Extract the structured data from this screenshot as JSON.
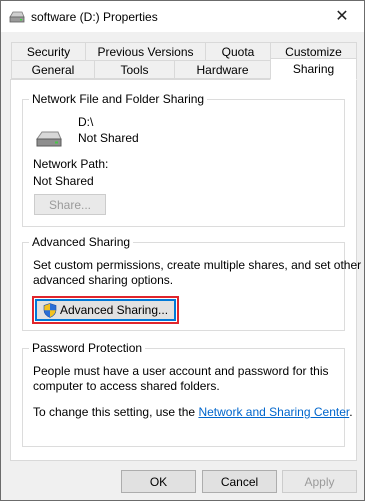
{
  "window": {
    "title": "software (D:) Properties",
    "close_glyph": "✕"
  },
  "tabs_row1": [
    "Security",
    "Previous Versions",
    "Quota",
    "Customize"
  ],
  "tabs_row2": [
    "General",
    "Tools",
    "Hardware",
    "Sharing"
  ],
  "active_tab": "Sharing",
  "network_sharing": {
    "legend": "Network File and Folder Sharing",
    "drive_name": "D:\\",
    "drive_status": "Not Shared",
    "path_label": "Network Path:",
    "path_value": "Not Shared",
    "share_button": "Share..."
  },
  "advanced_sharing": {
    "legend": "Advanced Sharing",
    "description_line1": "Set custom permissions, create multiple shares, and set other",
    "description_line2": "advanced sharing options.",
    "button_label": "Advanced Sharing...",
    "highlight_color": "#e0262d"
  },
  "password_protection": {
    "legend": "Password Protection",
    "line1": "People must have a user account and password for this",
    "line2": "computer to access shared folders.",
    "change_prefix": "To change this setting, use the",
    "link_text": "Network and Sharing Center",
    "change_suffix": "."
  },
  "footer": {
    "ok": "OK",
    "cancel": "Cancel",
    "apply": "Apply"
  },
  "icons": {
    "title": "drive-icon",
    "drive": "hard-drive-icon",
    "shield": "uac-shield-icon"
  },
  "colors": {
    "link": "#0066cc",
    "highlight_border": "#e0262d",
    "focus_border": "#0078d7"
  }
}
